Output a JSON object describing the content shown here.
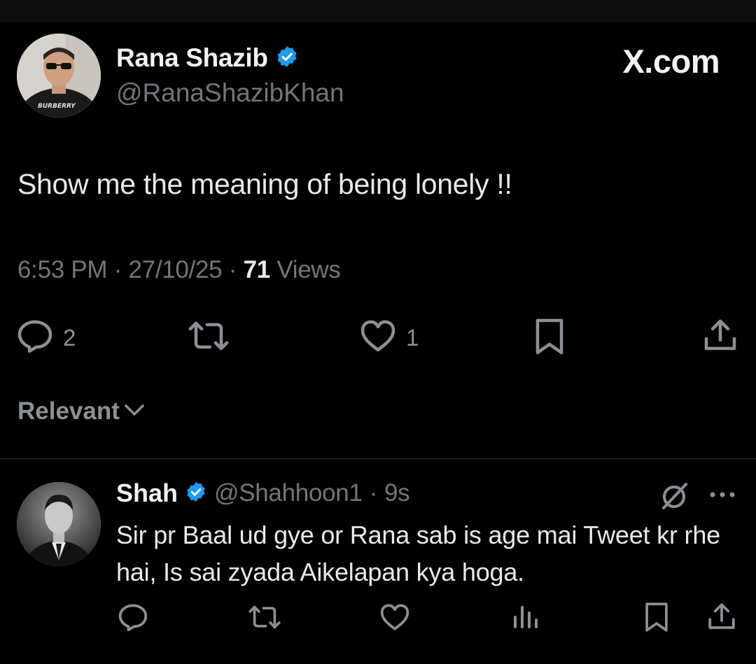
{
  "tweet": {
    "author": {
      "display_name": "Rana Shazib",
      "handle": "@RanaShazibKhan",
      "verified": true,
      "avatar_shirt_text": "BURBERRY"
    },
    "brand": "X.com",
    "text": "Show me the meaning of being lonely !!",
    "time": "6:53 PM",
    "date": "27/10/25",
    "views_count": "71",
    "views_label": "Views",
    "separator": "·",
    "actions": {
      "replies": "2",
      "likes": "1"
    },
    "icons": [
      "reply-icon",
      "retweet-icon",
      "like-icon",
      "bookmark-icon",
      "share-icon"
    ]
  },
  "sort": {
    "label": "Relevant"
  },
  "reply": {
    "display_name": "Shah",
    "handle": "@Shahhoon1",
    "separator": "·",
    "time": "9s",
    "verified": true,
    "text": "Sir pr Baal ud gye or Rana sab is age mai Tweet kr rhe hai, Is sai zyada Aikelapan kya hoga.",
    "icons": [
      "grok-icon",
      "more-icon",
      "reply-icon",
      "retweet-icon",
      "like-icon",
      "views-icon",
      "bookmark-icon",
      "share-icon"
    ]
  },
  "colors": {
    "background": "#000000",
    "text": "#e7e9ea",
    "muted": "#71767b",
    "verified": "#1d9bf0",
    "divider": "#2f3336"
  }
}
